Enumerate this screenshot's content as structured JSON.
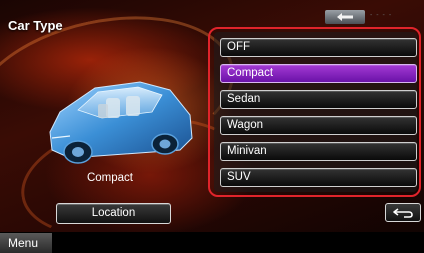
{
  "screen": {
    "title": "Car Type",
    "top_right_label": "- - - -"
  },
  "car_preview": {
    "label": "Compact",
    "icon": "car-preview-icon"
  },
  "options": [
    {
      "label": "OFF",
      "selected": false
    },
    {
      "label": "Compact",
      "selected": true
    },
    {
      "label": "Sedan",
      "selected": false
    },
    {
      "label": "Wagon",
      "selected": false
    },
    {
      "label": "Minivan",
      "selected": false
    },
    {
      "label": "SUV",
      "selected": false
    }
  ],
  "buttons": {
    "location_label": "Location",
    "menu_label": "Menu",
    "return_icon": "return-icon",
    "back_icon": "back-arrow-icon"
  },
  "colors": {
    "selection_accent": "#8a2bc2",
    "frame_highlight": "#e0242b",
    "background": "#3a0c05"
  }
}
